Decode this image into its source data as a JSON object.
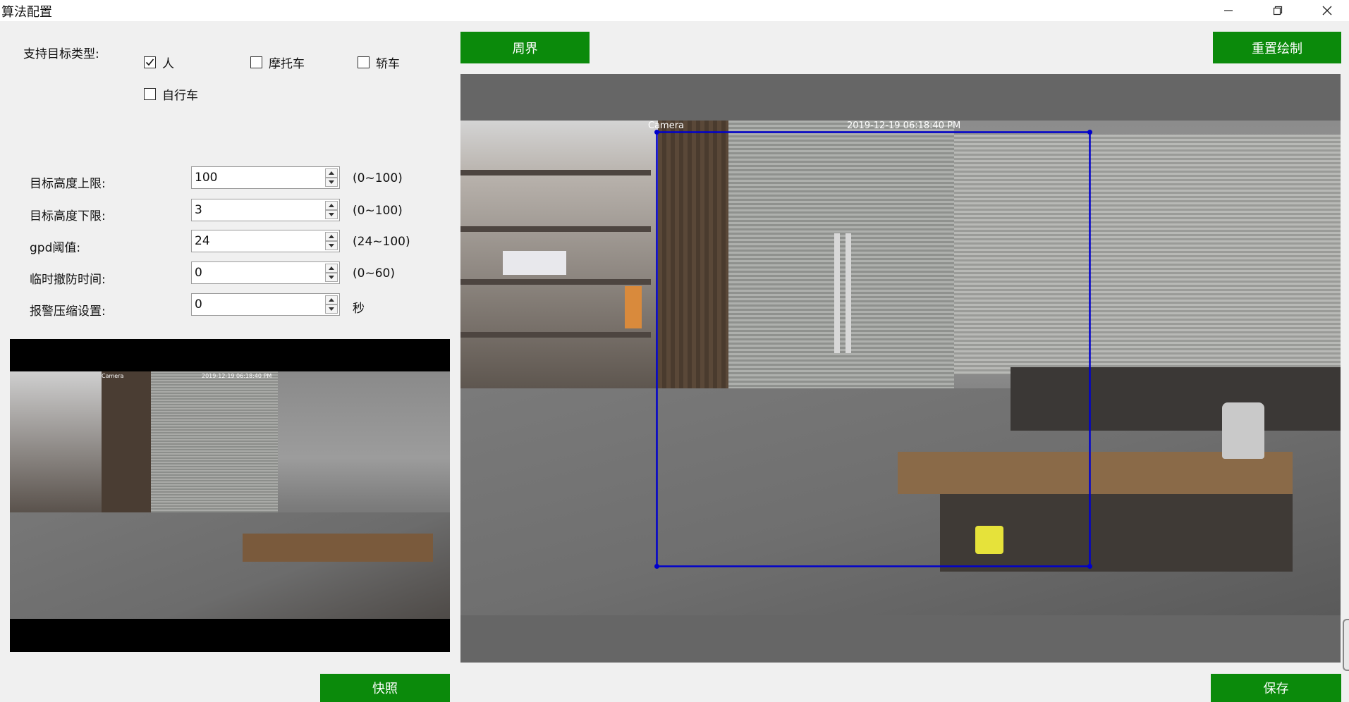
{
  "window": {
    "title": "算法配置"
  },
  "target_types": {
    "label": "支持目标类型:",
    "options": [
      {
        "label": "人",
        "checked": true
      },
      {
        "label": "摩托车",
        "checked": false
      },
      {
        "label": "轿车",
        "checked": false
      },
      {
        "label": "自行车",
        "checked": false
      }
    ]
  },
  "fields": [
    {
      "label": "目标高度上限:",
      "value": "100",
      "hint": "(0~100)"
    },
    {
      "label": "目标高度下限:",
      "value": "3",
      "hint": "(0~100)"
    },
    {
      "label": "gpd阈值:",
      "value": "24",
      "hint": "(24~100)"
    },
    {
      "label": "临时撤防时间:",
      "value": "0",
      "hint": "(0~60)"
    },
    {
      "label": "报警压缩设置:",
      "value": "0",
      "hint": "秒"
    }
  ],
  "buttons": {
    "perimeter": "周界",
    "redraw": "重置绘制",
    "snapshot": "快照",
    "save": "保存"
  },
  "video": {
    "camera_label": "Camera",
    "timestamp": "2019-12-19 06:18:40 PM",
    "thumb_camera_label": "Camera",
    "thumb_timestamp": "2019-12-19 06:18:40 PM"
  },
  "colors": {
    "button_green": "#0b8a0b",
    "region_blue": "#0000cc",
    "canvas_gray": "#666666"
  },
  "icons": [
    "minimize-icon",
    "restore-icon",
    "close-icon",
    "checkbox-checked-icon",
    "checkbox-unchecked-icon",
    "spin-up-icon",
    "spin-down-icon"
  ]
}
